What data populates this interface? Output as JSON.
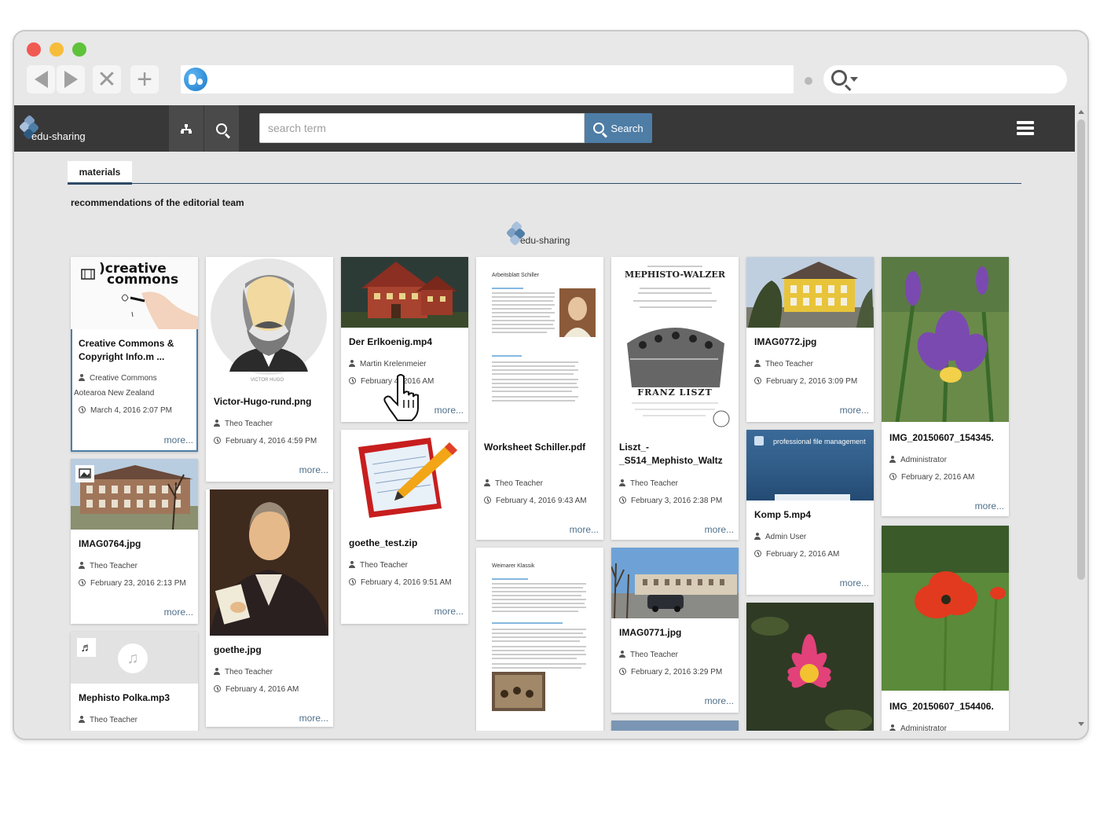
{
  "app": {
    "logo_text": "edu-sharing",
    "search_placeholder": "search term",
    "search_button": "Search"
  },
  "tabs": [
    {
      "label": "materials"
    }
  ],
  "section_title": "recommendations of the editorial team",
  "editorial_logo_text": "edu-sharing",
  "more_label": "more...",
  "cards": [
    {
      "title": "Creative Commons & Copyright Info.m ...",
      "author": "Creative Commons",
      "author_extra": "Aotearoa New Zealand",
      "date": "March 4, 2016 2:07 PM",
      "thumb": "creative-commons",
      "type_icon": "video-icon"
    },
    {
      "title": "IMAG0764.jpg",
      "author": "Theo Teacher",
      "date": "February 23, 2016 2:13 PM",
      "thumb": "building",
      "type_icon": "image-icon"
    },
    {
      "title": "Mephisto Polka.mp3",
      "author": "Theo Teacher",
      "date": "",
      "thumb": "audio",
      "type_icon": "music-icon"
    },
    {
      "title": "Victor-Hugo-rund.png",
      "author": "Theo Teacher",
      "date": "February 4, 2016 4:59 PM",
      "thumb": "victor-hugo",
      "caption": "VICTOR HUGO"
    },
    {
      "title": "goethe.jpg",
      "author": "Theo Teacher",
      "date": "February 4, 2016 AM",
      "thumb": "goethe"
    },
    {
      "title": "Der Erlkoenig.mp4",
      "author": "Martin  Krelenmeier",
      "date": "February 4, 2016 AM",
      "thumb": "house"
    },
    {
      "title": "goethe_test.zip",
      "author": "Theo Teacher",
      "date": "February 4, 2016 9:51 AM",
      "thumb": "notepad"
    },
    {
      "title": "Worksheet Schiller.pdf",
      "author": "Theo Teacher",
      "date": "February 4, 2016 9:43 AM",
      "thumb": "worksheet",
      "doc_heading": "Arbeitsblatt Schiller"
    },
    {
      "title": "",
      "author": "",
      "date": "",
      "thumb": "weimar",
      "doc_heading": "Weimarer Klassik"
    },
    {
      "title": "Liszt_-_S514_Mephisto_Waltz",
      "author": "Theo Teacher",
      "date": "February 3, 2016 2:38 PM",
      "thumb": "liszt",
      "score_title": "MEPHISTO-WALZER",
      "score_author": "FRANZ LISZT"
    },
    {
      "title": "IMAG0771.jpg",
      "author": "Theo Teacher",
      "date": "February 2, 2016 3:29 PM",
      "thumb": "street"
    },
    {
      "title": "IMAG0772.jpg",
      "author": "Theo Teacher",
      "date": "February 2, 2016 3:09 PM",
      "thumb": "yellow-house"
    },
    {
      "title": "Komp 5.mp4",
      "author": "Admin User",
      "date": "February 2, 2016 AM",
      "thumb": "pro-file",
      "overlay_text": "professional file management"
    },
    {
      "title": "",
      "author": "",
      "date": "",
      "thumb": "waterlily"
    },
    {
      "title": "IMG_20150607_154345.",
      "author": "Administrator",
      "date": "February 2, 2016 AM",
      "thumb": "iris"
    },
    {
      "title": "IMG_20150607_154406.",
      "author": "Administrator",
      "date": "",
      "thumb": "poppy"
    }
  ],
  "colors": {
    "header_bg": "#383838",
    "accent": "#4e7da6",
    "content_bg": "#e6e6e6",
    "tab_underline": "#2d4a66"
  }
}
